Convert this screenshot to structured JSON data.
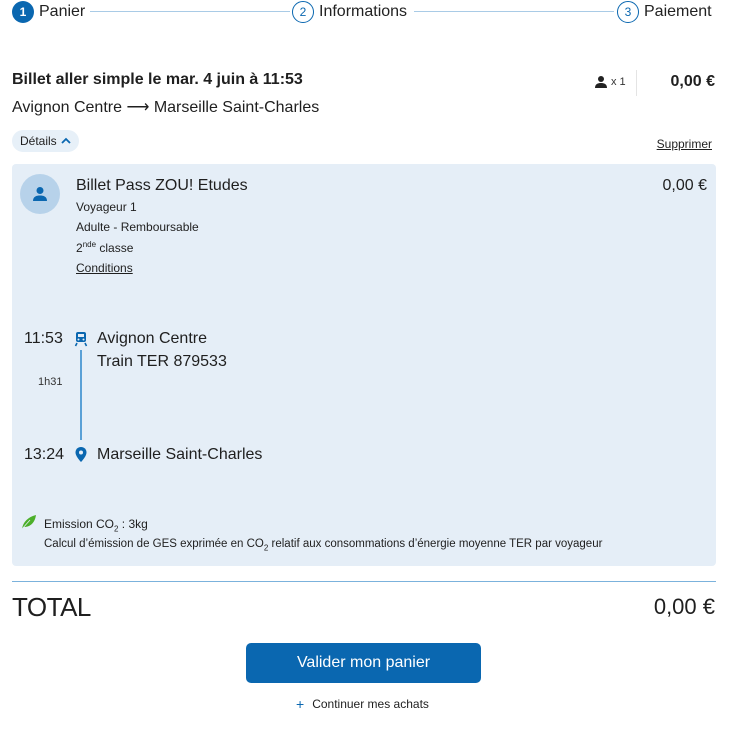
{
  "stepper": {
    "steps": [
      {
        "number": "1",
        "label": "Panier",
        "active": true
      },
      {
        "number": "2",
        "label": "Informations",
        "active": false
      },
      {
        "number": "3",
        "label": "Paiement",
        "active": false
      }
    ]
  },
  "trip": {
    "title": "Billet aller simple le mar. 4 juin à 11:53",
    "route": "Avignon Centre ⟶ Marseille Saint-Charles",
    "passengers": "x 1",
    "price": "0,00 €",
    "details_label": "Détails",
    "delete_label": "Supprimer"
  },
  "ticket": {
    "name": "Billet Pass ZOU! Etudes",
    "price": "0,00 €",
    "traveler": "Voyageur 1",
    "fare": "Adulte - Remboursable",
    "class_ordinal": "2",
    "class_suffix": "nde",
    "class_label": "classe",
    "conditions_label": "Conditions"
  },
  "journey": {
    "departure_time": "11:53",
    "departure_station": "Avignon Centre",
    "train": "Train TER 879533",
    "duration": "1h31",
    "arrival_time": "13:24",
    "arrival_station": "Marseille Saint-Charles"
  },
  "emission": {
    "label_prefix": "Emission CO",
    "label_sub": "2",
    "label_suffix": " : 3kg",
    "desc_prefix": "Calcul d’émission de GES exprimée en CO",
    "desc_sub": "2",
    "desc_suffix": " relatif aux consommations d’énergie moyenne TER par voyageur"
  },
  "total": {
    "label": "TOTAL",
    "value": "0,00 €"
  },
  "actions": {
    "validate_label": "Valider mon panier",
    "continue_label": "Continuer mes achats"
  },
  "colors": {
    "primary": "#0a67b0",
    "panel_bg": "#e5eef7",
    "leaf": "#4caf2a"
  }
}
